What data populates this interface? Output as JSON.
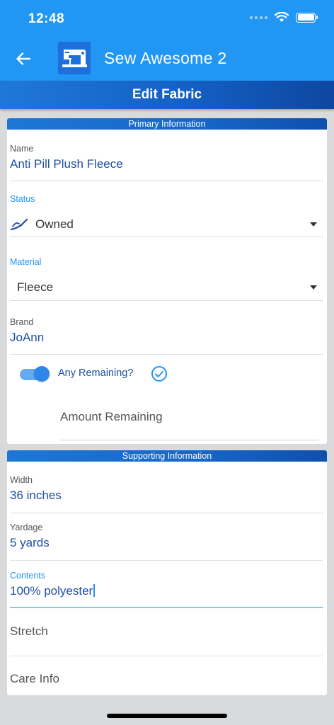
{
  "status_bar": {
    "time": "12:48"
  },
  "app_bar": {
    "title": "Sew Awesome 2"
  },
  "page": {
    "title": "Edit Fabric"
  },
  "primary": {
    "header": "Primary Information",
    "name": {
      "label": "Name",
      "value": "Anti Pill Plush Fleece"
    },
    "status": {
      "label": "Status",
      "value": "Owned"
    },
    "material": {
      "label": "Material",
      "value": "Fleece"
    },
    "brand": {
      "label": "Brand",
      "value": "JoAnn"
    },
    "any_remaining": {
      "label": "Any Remaining?",
      "on": true
    },
    "amount_remaining": {
      "placeholder": "Amount Remaining"
    }
  },
  "supporting": {
    "header": "Supporting Information",
    "width": {
      "label": "Width",
      "value": "36 inches"
    },
    "yardage": {
      "label": "Yardage",
      "value": "5 yards"
    },
    "contents": {
      "label": "Contents",
      "value": "100% polyester"
    },
    "stretch": {
      "placeholder": "Stretch"
    },
    "care_info": {
      "placeholder": "Care Info"
    }
  },
  "colors": {
    "primary": "#2196f3",
    "header_dark": "#0d47a1",
    "value_text": "#1e4fa8"
  }
}
